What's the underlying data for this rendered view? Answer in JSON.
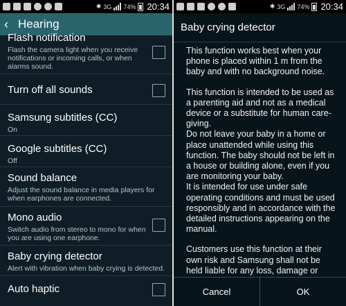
{
  "left_status": {
    "network": "3G",
    "battery": "74%",
    "time": "20:34"
  },
  "right_status": {
    "network": "3G",
    "battery": "74%",
    "time": "20:34"
  },
  "header": {
    "back_icon": "chevron-left-icon",
    "title": "Hearing"
  },
  "settings": [
    {
      "title": "Flash notification",
      "subtitle": "Flash the camera light when you receive notifications or incoming calls, or when alarms sound.",
      "checkbox": true,
      "checked": false
    },
    {
      "title": "Turn off all sounds",
      "subtitle": "",
      "checkbox": true,
      "checked": false
    },
    {
      "title": "Samsung subtitles (CC)",
      "subtitle": "On",
      "checkbox": false
    },
    {
      "title": "Google subtitles (CC)",
      "subtitle": "Off",
      "checkbox": false
    },
    {
      "title": "Sound balance",
      "subtitle": "Adjust the sound balance in media players for when earphones are connected.",
      "checkbox": false
    },
    {
      "title": "Mono audio",
      "subtitle": "Switch audio from stereo to mono for when you are using one earphone.",
      "checkbox": true,
      "checked": false
    },
    {
      "title": "Baby crying detector",
      "subtitle": "Alert with vibration when baby crying is detected.",
      "checkbox": false
    },
    {
      "title": "Auto haptic",
      "subtitle": "",
      "checkbox": true,
      "checked": false
    }
  ],
  "dialog": {
    "title": "Baby crying detector",
    "paragraphs": [
      "This function works best when your phone is placed within 1 m from the baby and with no background noise.",
      "This function is intended to be used as a parenting aid and not as a medical device or a substitute for human care-giving.",
      "Do not leave your baby in a home or place unattended while using this function. The baby should not be left in a house or building alone, even if you are monitoring your baby.",
      "It is intended for use under safe operating conditions and must be used responsibly and in accordance with the detailed instructions appearing on the manual.",
      "Customers use this function at their own risk and Samsung shall not be held liable for any loss, damage or injury, including consequential loss, damage or injury suffered by the"
    ],
    "cancel_label": "Cancel",
    "ok_label": "OK"
  }
}
